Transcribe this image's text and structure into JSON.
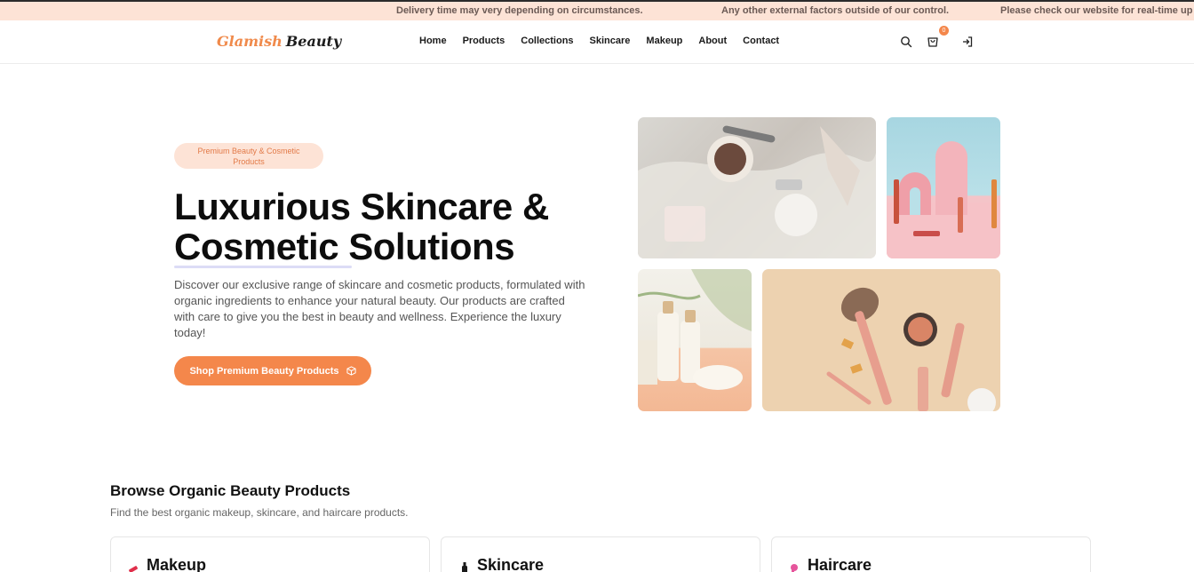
{
  "announcement": {
    "messages": [
      "Delivery time may very depending on circumstances.",
      "Any other external factors outside of our control.",
      "Please check our website for real-time up"
    ]
  },
  "header": {
    "logo_part1": "Glamish",
    "logo_part2": "Beauty",
    "nav": [
      "Home",
      "Products",
      "Collections",
      "Skincare",
      "Makeup",
      "About",
      "Contact"
    ],
    "cart_count": "0"
  },
  "hero": {
    "tag": "Premium Beauty & Cosmetic Products",
    "title": "Luxurious Skincare & Cosmetic Solutions",
    "description": "Discover our exclusive range of skincare and cosmetic products, formulated with organic ingredients to enhance your natural beauty. Our products are crafted with care to give you the best in beauty and wellness. Experience the luxury today!",
    "cta": "Shop Premium Beauty Products"
  },
  "browse": {
    "title": "Browse Organic Beauty Products",
    "subtitle": "Find the best organic makeup, skincare, and haircare products.",
    "categories": [
      "Makeup",
      "Skincare",
      "Haircare"
    ]
  },
  "colors": {
    "accent": "#f4874b",
    "announce_bg": "#fde3d6"
  }
}
